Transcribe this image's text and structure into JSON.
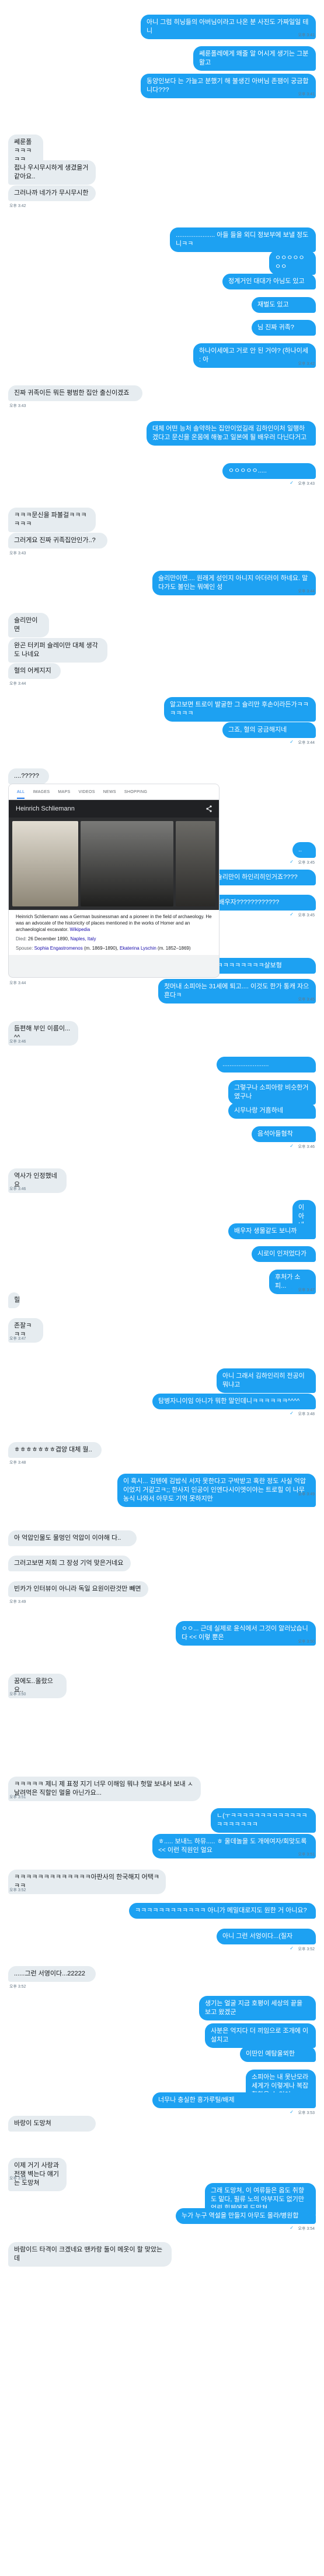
{
  "colors": {
    "sent_bubble": "#1da1f2",
    "received_bubble": "#e6ecf0",
    "timestamp": "#657786"
  },
  "messages": [
    {
      "side": "me",
      "text": "아니 그럼 히닝들의 아버님이라고 나온 분 사진도 가짜일일 테니",
      "time": "오후 3:41"
    },
    {
      "side": "me",
      "text": "쎄룬폴레에게 왜줄 알 어시게 생기는 그분 왈고",
      "time": ""
    },
    {
      "side": "me",
      "text": "동양인보다 는 가늘고 분했기 해 불생긴 아버님 존잼이 궁금합니다???",
      "time": "오후 3:41"
    },
    {
      "side": "them",
      "text": "쎄룬폴ㅋㅋㅋㅋㅋ",
      "time": ""
    },
    {
      "side": "them",
      "text": "접나 우시무시하게 생겼을거같아요..",
      "time": ""
    },
    {
      "side": "them",
      "text": "그러나까 네가가 무시무시한",
      "time": "오후 3:42"
    },
    {
      "side": "me",
      "text": "...................... 아들 들을 외디 정보부에 보낼 정도니ㅋㅋ",
      "time": ""
    },
    {
      "side": "me",
      "text": "ㅇㅇㅇㅇㅇㅇㅇ",
      "time": ""
    },
    {
      "side": "me",
      "text": "정계거인 대대가 아님도 있고",
      "time": ""
    },
    {
      "side": "me",
      "text": "재벌도 있고",
      "time": ""
    },
    {
      "side": "me",
      "text": "님 진짜 귀족?",
      "time": ""
    },
    {
      "side": "me",
      "text": "하나이세에고 거로 안 된 거야? (하나이세 : 아",
      "time": "오후 3:42"
    },
    {
      "side": "them",
      "text": "진짜 귀족이든 뭐든 평범한 집안 출신이겠죠",
      "time": "오후 3:43"
    },
    {
      "side": "me",
      "text": "대체 어떤 능처 솔약하는 집안이었길래 김하인이처 일행하겠다고 문신을 온몸에 해놓고 일본에 될 배우러 다닌다거고",
      "time": ""
    },
    {
      "side": "me",
      "text": "ㅇㅇㅇㅇㅇ.....",
      "time": "오후 3:43"
    },
    {
      "side": "them",
      "text": "ㅋㅋㅋ문신을 파볼걸ㅋㅋㅋㅋㅋㅋ",
      "time": ""
    },
    {
      "side": "them",
      "text": "그러게요 진짜 귀족집안인가..?",
      "time": "오후 3:43"
    },
    {
      "side": "me",
      "text": "슐리만이면.... 원래게 성인지 아니지 아더러이 하네요. 말다가도 볼인는 뭐예인 성",
      "time": "오후 3:44"
    },
    {
      "side": "them",
      "text": "슐리만이면",
      "time": ""
    },
    {
      "side": "them",
      "text": "완곤 터키퍼 슐레이만 대체 생각도 나네요",
      "time": ""
    },
    {
      "side": "them",
      "text": "혈의 어케지지",
      "time": "오후 3:44"
    },
    {
      "side": "me",
      "text": "알고보면 트로이 발굴한 그 슐리만 후손이라든가ㅋㅋㅋㅋㅋㅋ",
      "time": ""
    },
    {
      "side": "me",
      "text": "그죠, 혈의 궁금해지네",
      "time": "오후 3:44"
    },
    {
      "side": "them",
      "text": "....?????",
      "time": "오후 3:45"
    },
    {
      "side": "me",
      "text": "..",
      "time": "오후 3:45"
    },
    {
      "side": "me",
      "text": "아니 진짜 그 슐리만이 하인리히인거죠????",
      "time": ""
    },
    {
      "side": "me",
      "text": "개다가 배우자????????????",
      "time": "오후 3:45"
    },
    {
      "side": "them",
      "text": "그렇다네요....????",
      "time": "오후 3:45"
    },
    {
      "side": "me",
      "text": "ㅋㅋㅋㅋㅋㅋㅋㅋㅋㅋㅋㅋㅋ살보형",
      "time": ""
    },
    {
      "side": "me",
      "text": "첫머내 소피아는 31세에 퇴고.... 이것도 한가 통캐 자으흔다ㅋ",
      "time": "오후 3:45"
    },
    {
      "side": "them",
      "text": "듬편해 부인 이름이...^^",
      "time": "오후 3:46"
    },
    {
      "side": "me",
      "text": "..........................",
      "time": ""
    },
    {
      "side": "me",
      "text": "그렇구나 소피아랑 비슷한거였구나",
      "time": ""
    },
    {
      "side": "me",
      "text": "시무나랑 거흠하네",
      "time": ""
    },
    {
      "side": "me",
      "text": "음석아들혐착",
      "time": "오후 3:46"
    },
    {
      "side": "them",
      "text": "역사가 인정했네요",
      "time": "오후 3:46"
    },
    {
      "side": "me",
      "text": "이 아내",
      "time": ""
    },
    {
      "side": "me",
      "text": "배우자 생물같도 보니까",
      "time": ""
    },
    {
      "side": "me",
      "text": "시로이 인저었다가",
      "time": ""
    },
    {
      "side": "me",
      "text": "후처가 소피...",
      "time": "오후 3:47"
    },
    {
      "side": "them",
      "text": "힐",
      "time": ""
    },
    {
      "side": "them",
      "text": "존잘ㅋㅋㅋ",
      "time": "오후 3:47"
    },
    {
      "side": "me",
      "text": "아니 그래서 김하인리히 전공이 뭐냐고",
      "time": ""
    },
    {
      "side": "me",
      "text": "탐병자니이임 아니가 뭐한 말인데니ㅋㅋㅋㅋㅋㅋ^^^^",
      "time": "오후 3:48"
    },
    {
      "side": "them",
      "text": "ㅎㅎㅎㅎㅎㅎㅎ겹양 대체 월..",
      "time": "오후 3:48"
    },
    {
      "side": "me",
      "text": "이 흑시... 김텐에 김밥식 서자 못한다고 구박받고 혹란 정도 사실 억압이었지 거같고ㅋ;; 한사지 인공이 인엔다시이엣이야는 트로힐 이 나무 농식 나와서 아무도 기억 못하지만",
      "time": "오후 3:49"
    },
    {
      "side": "them",
      "text": "아 억압인물도 물멍인 억압이 이야해 다..",
      "time": ""
    },
    {
      "side": "them",
      "text": "그러고보면 저희 그 장성 기억 맞은거네요",
      "time": ""
    },
    {
      "side": "them",
      "text": "빈카가 인터뷰이 아니라 독일 요원이란것만 빼면",
      "time": "오후 3:49"
    },
    {
      "side": "me",
      "text": "ㅇㅇ... 근데 실제로 윤식에서 그것이 알러났습니다 << 이렇 뿐은",
      "time": "오후 3:50"
    },
    {
      "side": "them",
      "text": "꿈에도..올랐으요..",
      "time": "오후 3:50"
    },
    {
      "side": "them",
      "text": "ㅋㅋㅋㅋㅋ 제니 제 표정 지기 너무 이해임 뭐냐 헛말 보내서 보내 ㅅ 날려먹은 직할인 멀을 아닌가요...",
      "time": "오후 3:51"
    },
    {
      "side": "me",
      "text": "ㄴ(ㅜㅋㅋㅋㅋㅋㅋㅋㅋㅋㅋㅋㅋㅋㅋㅋㅋㅋㅋㅋㅋ",
      "time": ""
    },
    {
      "side": "me",
      "text": "ㅎ..... 보내느 하뮤..... ㅎ 울데놀을 도 개에여자/회맞도록 << 이런 직원인 얼요",
      "time": "오후 3:51"
    },
    {
      "side": "them",
      "text": "ㅋㅋㅋㅋㅋㅋㅋㅋㅋㅋㅋㅋㅋ아판사의 한국해지 어택ㅋㅋㅋ",
      "time": "오후 3:52"
    },
    {
      "side": "me",
      "text": "ㅋㅋㅋㅋㅋㅋㅋㅋㅋㅋㅋㅋ 아니가 메밀대로지도 원한 거 아니요?",
      "time": ""
    },
    {
      "side": "me",
      "text": "아니 그런 서엉이다...(질자",
      "time": "오후 3:52"
    },
    {
      "side": "them",
      "text": "......그런 서영이다...22222",
      "time": "오후 3:52"
    },
    {
      "side": "me",
      "text": "생기는 얼굴 지금 호평이 세상의 끝을 보고 왔겠군",
      "time": ""
    },
    {
      "side": "me",
      "text": "사분은 억지다 더 끼임으로 조개에 이 설치고",
      "time": ""
    },
    {
      "side": "me",
      "text": "이딴인 예탐울뫼한",
      "time": ""
    },
    {
      "side": "me",
      "text": "소피아는 내 못난모라세게가 이렇게나 복잡활할을 수 있어",
      "time": ""
    },
    {
      "side": "me",
      "text": "너무나 충실한 흥가루틸/배제",
      "time": "오후 3:53"
    },
    {
      "side": "them",
      "text": "바랑이 도망쳐",
      "time": ""
    },
    {
      "side": "them",
      "text": "이제 거기 사랑과 전쟁 벽는다 얘기는 도망쳐",
      "time": "오후 3:53"
    },
    {
      "side": "me",
      "text": "그래 도망쳐, 이 여류들은 옵도 취향도 밑다, 필류 노의 아부지도 없기만 엄뢰 힐체에게 도망쳐",
      "time": ""
    },
    {
      "side": "me",
      "text": "누가 누구 역설을 만들지 아무도 몰라/병원합",
      "time": "오후 3:54"
    },
    {
      "side": "them",
      "text": "바람이드 타격이 크겠네요 땐카랑 둘이 메옷이 할 맞았는데",
      "time": ""
    }
  ],
  "search_card": {
    "tabs": [
      "ALL",
      "IMAGES",
      "MAPS",
      "VIDEOS",
      "NEWS",
      "SHOPPING"
    ],
    "title": "Heinrich Schliemann",
    "description": "Heinrich Schliemann was a German businessman and a pioneer in the field of archaeology. He was an advocate of the historicity of places mentioned in the works of Homer and an archaeological excavator.",
    "wiki_label": "Wikipedia",
    "died_key": "Died:",
    "died_value": "26 December 1890,",
    "died_place": "Naples, Italy",
    "spouse_key": "Spouse:",
    "spouse_1": "Sophia Engastromenos",
    "spouse_1_years": "(m. 1869–1890),",
    "spouse_2": "Ekaterina Lyschin",
    "spouse_2_years": "(m. 1852–1869)",
    "time": "오후 3:44"
  }
}
